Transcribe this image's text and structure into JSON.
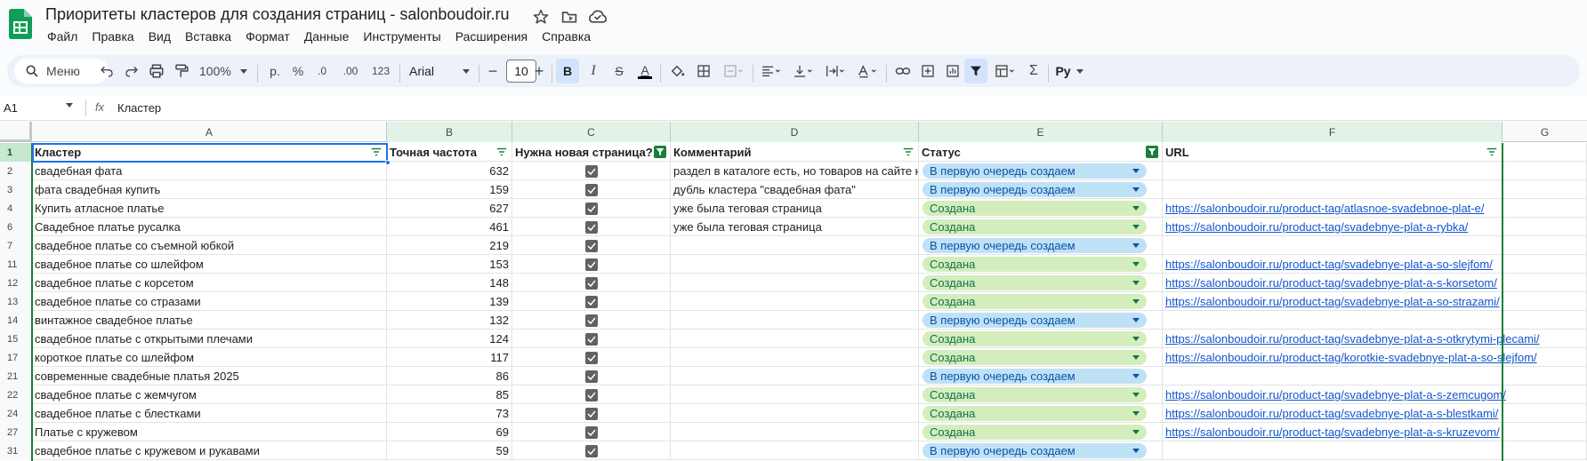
{
  "app": {
    "title": "Приоритеты кластеров для создания страниц - salonboudoir.ru",
    "menu": [
      "Файл",
      "Правка",
      "Вид",
      "Вставка",
      "Формат",
      "Данные",
      "Инструменты",
      "Расширения",
      "Справка"
    ]
  },
  "toolbar": {
    "menu_label": "Меню",
    "zoom": "100%",
    "currency": "р.",
    "percent": "%",
    "dec_decrease": ".0",
    "dec_increase": ".00",
    "format_123": "123",
    "font": "Arial",
    "font_size": "10",
    "minus": "−",
    "plus": "+",
    "bold": "B",
    "italic": "I",
    "strike": "S",
    "text_color": "A",
    "sum": "Σ",
    "input_tools": "Pу"
  },
  "formula_bar": {
    "cell_ref": "A1",
    "fx": "fx",
    "content": "Кластер"
  },
  "columns": [
    "A",
    "B",
    "C",
    "D",
    "E",
    "F",
    "G"
  ],
  "header_row": {
    "num": "1",
    "a": "Кластер",
    "b": "Точная частота",
    "c": "Нужна новая страница?",
    "d": "Комментарий",
    "e": "Статус",
    "f": "URL"
  },
  "rows": [
    {
      "num": "2",
      "cluster": "свадебная фата",
      "freq": "632",
      "checked": true,
      "comment": "раздел в каталоге есть, но товаров на сайте нет",
      "status": "В первую очередь создаем",
      "status_color": "blue",
      "url": ""
    },
    {
      "num": "3",
      "cluster": "фата свадебная купить",
      "freq": "159",
      "checked": true,
      "comment": "дубль кластера \"свадебная фата\"",
      "status": "В первую очередь создаем",
      "status_color": "blue",
      "url": ""
    },
    {
      "num": "4",
      "cluster": "Купить атласное платье",
      "freq": "627",
      "checked": true,
      "comment": "уже была теговая страница",
      "status": "Создана",
      "status_color": "green",
      "url": "https://salonboudoir.ru/product-tag/atlasnoe-svadebnoe-plat-e/"
    },
    {
      "num": "6",
      "cluster": "Свадебное платье русалка",
      "freq": "461",
      "checked": true,
      "comment": "уже была теговая страница",
      "status": "Создана",
      "status_color": "green",
      "url": "https://salonboudoir.ru/product-tag/svadebnye-plat-a-rybka/"
    },
    {
      "num": "7",
      "cluster": "свадебное платье со съемной юбкой",
      "freq": "219",
      "checked": true,
      "comment": "",
      "status": "В первую очередь создаем",
      "status_color": "blue",
      "url": ""
    },
    {
      "num": "11",
      "cluster": "свадебное платье со шлейфом",
      "freq": "153",
      "checked": true,
      "comment": "",
      "status": "Создана",
      "status_color": "green",
      "url": "https://salonboudoir.ru/product-tag/svadebnye-plat-a-so-slejfom/"
    },
    {
      "num": "12",
      "cluster": "свадебное платье с корсетом",
      "freq": "148",
      "checked": true,
      "comment": "",
      "status": "Создана",
      "status_color": "green",
      "url": "https://salonboudoir.ru/product-tag/svadebnye-plat-a-s-korsetom/"
    },
    {
      "num": "13",
      "cluster": "свадебное платье со стразами",
      "freq": "139",
      "checked": true,
      "comment": "",
      "status": "Создана",
      "status_color": "green",
      "url": "https://salonboudoir.ru/product-tag/svadebnye-plat-a-so-strazami/"
    },
    {
      "num": "14",
      "cluster": "винтажное свадебное платье",
      "freq": "132",
      "checked": true,
      "comment": "",
      "status": "В первую очередь создаем",
      "status_color": "blue",
      "url": ""
    },
    {
      "num": "15",
      "cluster": "свадебное платье с открытыми плечами",
      "freq": "124",
      "checked": true,
      "comment": "",
      "status": "Создана",
      "status_color": "green",
      "url": "https://salonboudoir.ru/product-tag/svadebnye-plat-a-s-otkrytymi-plecami/"
    },
    {
      "num": "17",
      "cluster": "короткое платье со шлейфом",
      "freq": "117",
      "checked": true,
      "comment": "",
      "status": "Создана",
      "status_color": "green",
      "url": "https://salonboudoir.ru/product-tag/korotkie-svadebnye-plat-a-so-slejfom/"
    },
    {
      "num": "21",
      "cluster": "современные свадебные платья 2025",
      "freq": "86",
      "checked": true,
      "comment": "",
      "status": "В первую очередь создаем",
      "status_color": "blue",
      "url": ""
    },
    {
      "num": "22",
      "cluster": "свадебное платье с жемчугом",
      "freq": "85",
      "checked": true,
      "comment": "",
      "status": "Создана",
      "status_color": "green",
      "url": "https://salonboudoir.ru/product-tag/svadebnye-plat-a-s-zemcugom/"
    },
    {
      "num": "24",
      "cluster": "свадебное платье с блестками",
      "freq": "73",
      "checked": true,
      "comment": "",
      "status": "Создана",
      "status_color": "green",
      "url": "https://salonboudoir.ru/product-tag/svadebnye-plat-a-s-blestkami/"
    },
    {
      "num": "27",
      "cluster": "Платье с кружевом",
      "freq": "69",
      "checked": true,
      "comment": "",
      "status": "Создана",
      "status_color": "green",
      "url": "https://salonboudoir.ru/product-tag/svadebnye-plat-a-s-kruzevom/"
    },
    {
      "num": "31",
      "cluster": "свадебное платье с кружевом и рукавами",
      "freq": "59",
      "checked": true,
      "comment": "",
      "status": "В первую очередь создаем",
      "status_color": "blue",
      "url": ""
    }
  ],
  "colors": {
    "accent": "#1a73e8",
    "filter_green": "#188038",
    "chip_blue": "#bfe1f6",
    "chip_green": "#d4edbc",
    "link": "#1155cc"
  }
}
